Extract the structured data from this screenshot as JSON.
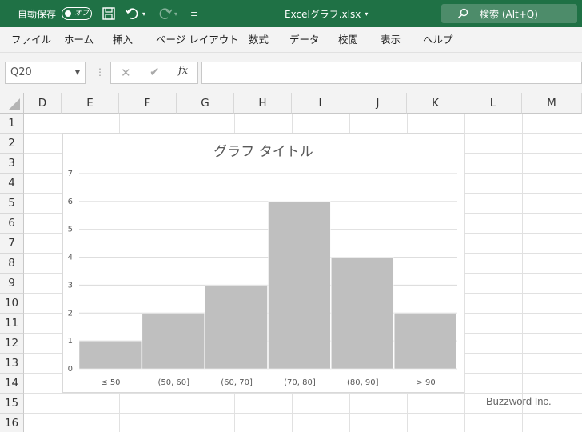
{
  "titlebar": {
    "autosave_label": "自動保存",
    "autosave_state": "オフ",
    "filename": "Excelグラフ.xlsx",
    "search_label": "検索 (Alt+Q)",
    "colors": {
      "bar": "#1f7145",
      "search": "#4d8c6a"
    }
  },
  "menu": {
    "items": [
      "ファイル",
      "ホーム",
      "挿入",
      "ページ レイアウト",
      "数式",
      "データ",
      "校閲",
      "表示",
      "ヘルプ"
    ]
  },
  "formula_bar": {
    "name_box": "Q20",
    "fx_label": "fx",
    "formula": ""
  },
  "grid": {
    "columns": [
      "D",
      "E",
      "F",
      "G",
      "H",
      "I",
      "J",
      "K",
      "L",
      "M"
    ],
    "rows": [
      "1",
      "2",
      "3",
      "4",
      "5",
      "6",
      "7",
      "8",
      "9",
      "10",
      "11",
      "12",
      "13",
      "14",
      "15",
      "16"
    ]
  },
  "chart_data": {
    "type": "bar",
    "title": "グラフ タイトル",
    "categories": [
      "≤ 50",
      "(50, 60]",
      "(60, 70]",
      "(70, 80]",
      "(80, 90]",
      "> 90"
    ],
    "values": [
      1,
      2,
      3,
      6,
      4,
      2
    ],
    "ylim": [
      0,
      7
    ],
    "yticks": [
      "0",
      "1",
      "2",
      "3",
      "4",
      "5",
      "6",
      "7"
    ],
    "grid": true,
    "bar_color": "#bfbfbf"
  },
  "watermark": "Buzzword Inc."
}
